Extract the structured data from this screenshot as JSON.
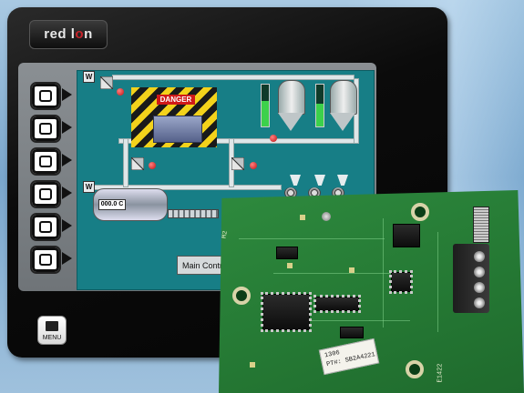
{
  "brand": {
    "logo_text_a": "red l",
    "logo_text_b": "o",
    "logo_text_c": "n"
  },
  "hmi": {
    "danger_label": "DANGER",
    "tank_temp": "000.0 C",
    "main_button_label": "Main Contr",
    "w_label": "W",
    "menu_label": "MENU",
    "softkey_count": 6
  },
  "gauges": [
    {
      "level": 0.6
    },
    {
      "level": 0.55
    }
  ],
  "pcb": {
    "sticker_line1": "1306",
    "sticker_line2": "PT#: SB2A4221",
    "silk_code": "E1422",
    "silk_mark": "M2"
  },
  "colors": {
    "screen_bg": "#177e86",
    "board_green": "#257934",
    "danger_red": "#d01919",
    "hazard_yellow": "#f3d21b"
  }
}
